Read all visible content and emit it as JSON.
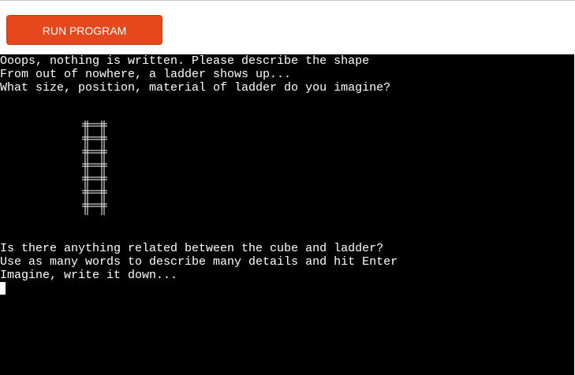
{
  "toolbar": {
    "run_label": "RUN PROGRAM"
  },
  "terminal": {
    "lines": [
      "Ooops, nothing is written. Please describe the shape",
      "From out of nowhere, a ladder shows up...",
      "What size, position, material of ladder do you imagine?",
      "Is there anything related between the cube and ladder?",
      "Use as many words to describe many details and hit Enter",
      "Imagine, write it down..."
    ],
    "ascii_art": "ladder",
    "cursor_visible": true
  },
  "colors": {
    "button_bg": "#e5481c",
    "terminal_bg": "#000000",
    "terminal_text": "#ffffff",
    "page_bg": "#ffffff"
  }
}
